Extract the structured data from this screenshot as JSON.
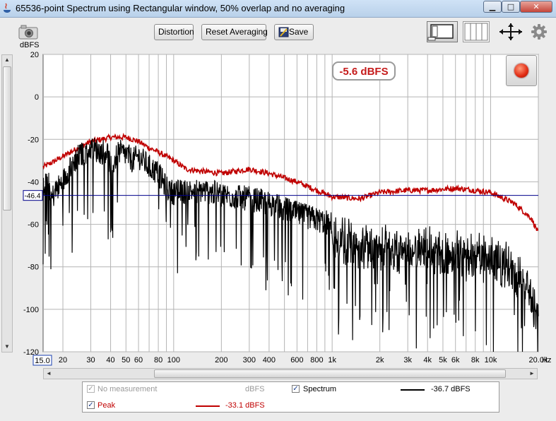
{
  "window": {
    "title": "65536-point Spectrum using Rectangular window, 50% overlap and no averaging",
    "minimize_symbol": "▁",
    "maximize_symbol": "□",
    "close_symbol": "✕"
  },
  "toolbar": {
    "distortion_label": "Distortion",
    "reset_averaging_label": "Reset Averaging",
    "save_label": "Save",
    "icons": [
      "camera-icon",
      "save-icon",
      "layout-view-icon",
      "bars-view-icon",
      "zoom-arrows-icon",
      "settings-gear-icon"
    ]
  },
  "readouts": {
    "peak_value": "-5.6 dBFS",
    "cursor_level": "-46.4",
    "x_start": "15.0"
  },
  "scrollbars": {
    "up": "▲",
    "down": "▼",
    "left": "◄",
    "right": "►"
  },
  "colors": {
    "peak": "#c00000",
    "spectrum": "#000000",
    "cursor": "#00008b",
    "grid": "#b4b4b4"
  },
  "chart_data": {
    "type": "line",
    "x_scale": "log",
    "xlim": [
      15,
      20000
    ],
    "ylim": [
      -120,
      20
    ],
    "y_unit": "dBFS",
    "x_unit": "Hz",
    "grid": true,
    "y_ticks": [
      20,
      0,
      -20,
      -40,
      -60,
      -80,
      -100,
      -120
    ],
    "x_ticks": [
      {
        "value": 20,
        "label": "20"
      },
      {
        "value": 30,
        "label": "30"
      },
      {
        "value": 40,
        "label": "40"
      },
      {
        "value": 50,
        "label": "50"
      },
      {
        "value": 60,
        "label": "60"
      },
      {
        "value": 80,
        "label": "80"
      },
      {
        "value": 100,
        "label": "100"
      },
      {
        "value": 200,
        "label": "200"
      },
      {
        "value": 300,
        "label": "300"
      },
      {
        "value": 400,
        "label": "400"
      },
      {
        "value": 600,
        "label": "600"
      },
      {
        "value": 800,
        "label": "800"
      },
      {
        "value": 1000,
        "label": "1k"
      },
      {
        "value": 2000,
        "label": "2k"
      },
      {
        "value": 3000,
        "label": "3k"
      },
      {
        "value": 4000,
        "label": "4k"
      },
      {
        "value": 5000,
        "label": "5k"
      },
      {
        "value": 6000,
        "label": "6k"
      },
      {
        "value": 8000,
        "label": "8k"
      },
      {
        "value": 10000,
        "label": "10k"
      },
      {
        "value": 20000,
        "label": "20.0k"
      }
    ],
    "cursor_y": -46.4,
    "series": [
      {
        "name": "Peak",
        "color": "#c00000",
        "points": [
          [
            15,
            -33
          ],
          [
            17,
            -31
          ],
          [
            20,
            -28
          ],
          [
            25,
            -24
          ],
          [
            30,
            -21
          ],
          [
            35,
            -20
          ],
          [
            40,
            -19
          ],
          [
            50,
            -19
          ],
          [
            60,
            -21
          ],
          [
            70,
            -24
          ],
          [
            80,
            -26
          ],
          [
            100,
            -30
          ],
          [
            120,
            -34
          ],
          [
            150,
            -35
          ],
          [
            200,
            -36
          ],
          [
            300,
            -34
          ],
          [
            400,
            -36
          ],
          [
            600,
            -40
          ],
          [
            800,
            -44
          ],
          [
            1000,
            -47
          ],
          [
            1500,
            -48
          ],
          [
            2000,
            -45
          ],
          [
            3000,
            -44
          ],
          [
            4000,
            -44
          ],
          [
            6000,
            -43
          ],
          [
            8000,
            -44
          ],
          [
            10000,
            -45
          ],
          [
            14000,
            -50
          ],
          [
            18000,
            -57
          ],
          [
            20000,
            -64
          ]
        ]
      },
      {
        "name": "Spectrum",
        "color": "#000000",
        "points": [
          [
            15,
            -42
          ],
          [
            16,
            -36
          ],
          [
            17,
            -48
          ],
          [
            18,
            -44
          ],
          [
            20,
            -40
          ],
          [
            22,
            -33
          ],
          [
            25,
            -28
          ],
          [
            28,
            -26
          ],
          [
            30,
            -24
          ],
          [
            35,
            -26
          ],
          [
            38,
            -25
          ],
          [
            40,
            -34
          ],
          [
            45,
            -26
          ],
          [
            50,
            -27
          ],
          [
            55,
            -30
          ],
          [
            60,
            -28
          ],
          [
            70,
            -33
          ],
          [
            80,
            -36
          ],
          [
            90,
            -43
          ],
          [
            100,
            -45
          ],
          [
            150,
            -44
          ],
          [
            200,
            -46
          ],
          [
            300,
            -48
          ],
          [
            400,
            -50
          ],
          [
            600,
            -55
          ],
          [
            1000,
            -60
          ],
          [
            2000,
            -64
          ],
          [
            4000,
            -66
          ],
          [
            8000,
            -68
          ],
          [
            12000,
            -72
          ],
          [
            16000,
            -80
          ],
          [
            20000,
            -96
          ]
        ]
      }
    ]
  },
  "legend": {
    "no_measurement": {
      "label": "No measurement",
      "unit": "dBFS",
      "checked": true,
      "enabled": false
    },
    "spectrum": {
      "label": "Spectrum",
      "value": "-36.7 dBFS",
      "checked": true,
      "color": "#000000"
    },
    "peak": {
      "label": "Peak",
      "value": "-33.1 dBFS",
      "checked": true,
      "color": "#c00000"
    },
    "check_mark": "✓"
  },
  "units": {
    "y": "dBFS",
    "x": "Hz"
  }
}
